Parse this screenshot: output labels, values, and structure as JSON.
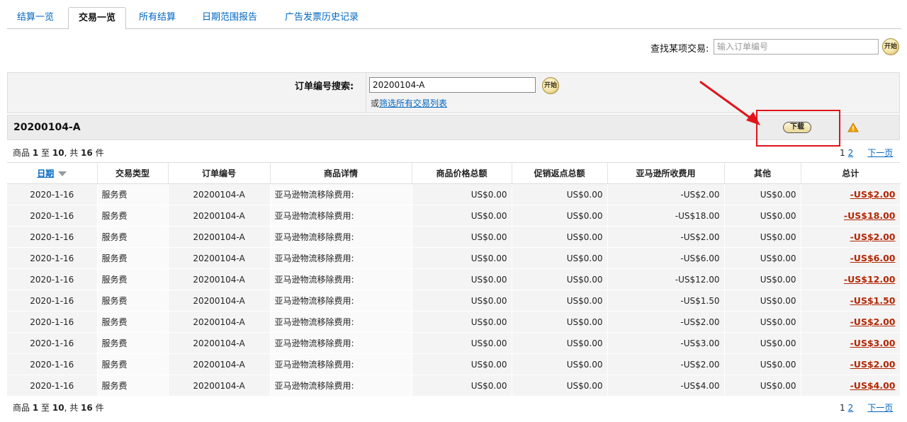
{
  "tabs": [
    {
      "label": "结算一览"
    },
    {
      "label": "交易一览"
    },
    {
      "label": "所有结算"
    },
    {
      "label": "日期范围报告"
    },
    {
      "label": "广告发票历史记录"
    }
  ],
  "find": {
    "label": "查找某项交易:",
    "placeholder": "输入订单编号",
    "go": "开始"
  },
  "order_search": {
    "label": "订单编号搜索:",
    "value": "20200104-A",
    "go": "开始",
    "or": "或",
    "filter_link": "筛选所有交易列表"
  },
  "header": {
    "title": "20200104-A",
    "download": "下载"
  },
  "summary": {
    "prefix": "商品",
    "from": "1",
    "to_word": "至",
    "to": "10",
    "total_word": ", 共",
    "total": "16",
    "unit": "件"
  },
  "pager": {
    "current": "1",
    "page2": "2",
    "next": "下一页"
  },
  "columns": [
    "日期",
    "交易类型",
    "订单编号",
    "商品详情",
    "商品价格总额",
    "促销返点总额",
    "亚马逊所收费用",
    "其他",
    "总计"
  ],
  "rows": [
    {
      "date": "2020-1-16",
      "type": "服务费",
      "order": "20200104-A",
      "detail": "亚马逊物流移除费用:",
      "price": "US$0.00",
      "promo": "US$0.00",
      "fee": "-US$2.00",
      "other": "US$0.00",
      "total": "-US$2.00"
    },
    {
      "date": "2020-1-16",
      "type": "服务费",
      "order": "20200104-A",
      "detail": "亚马逊物流移除费用:",
      "price": "US$0.00",
      "promo": "US$0.00",
      "fee": "-US$18.00",
      "other": "US$0.00",
      "total": "-US$18.00"
    },
    {
      "date": "2020-1-16",
      "type": "服务费",
      "order": "20200104-A",
      "detail": "亚马逊物流移除费用:",
      "price": "US$0.00",
      "promo": "US$0.00",
      "fee": "-US$2.00",
      "other": "US$0.00",
      "total": "-US$2.00"
    },
    {
      "date": "2020-1-16",
      "type": "服务费",
      "order": "20200104-A",
      "detail": "亚马逊物流移除费用:",
      "price": "US$0.00",
      "promo": "US$0.00",
      "fee": "-US$6.00",
      "other": "US$0.00",
      "total": "-US$6.00"
    },
    {
      "date": "2020-1-16",
      "type": "服务费",
      "order": "20200104-A",
      "detail": "亚马逊物流移除费用:",
      "price": "US$0.00",
      "promo": "US$0.00",
      "fee": "-US$12.00",
      "other": "US$0.00",
      "total": "-US$12.00"
    },
    {
      "date": "2020-1-16",
      "type": "服务费",
      "order": "20200104-A",
      "detail": "亚马逊物流移除费用:",
      "price": "US$0.00",
      "promo": "US$0.00",
      "fee": "-US$1.50",
      "other": "US$0.00",
      "total": "-US$1.50"
    },
    {
      "date": "2020-1-16",
      "type": "服务费",
      "order": "20200104-A",
      "detail": "亚马逊物流移除费用:",
      "price": "US$0.00",
      "promo": "US$0.00",
      "fee": "-US$2.00",
      "other": "US$0.00",
      "total": "-US$2.00"
    },
    {
      "date": "2020-1-16",
      "type": "服务费",
      "order": "20200104-A",
      "detail": "亚马逊物流移除费用:",
      "price": "US$0.00",
      "promo": "US$0.00",
      "fee": "-US$3.00",
      "other": "US$0.00",
      "total": "-US$3.00"
    },
    {
      "date": "2020-1-16",
      "type": "服务费",
      "order": "20200104-A",
      "detail": "亚马逊物流移除费用:",
      "price": "US$0.00",
      "promo": "US$0.00",
      "fee": "-US$2.00",
      "other": "US$0.00",
      "total": "-US$2.00"
    },
    {
      "date": "2020-1-16",
      "type": "服务费",
      "order": "20200104-A",
      "detail": "亚马逊物流移除费用:",
      "price": "US$0.00",
      "promo": "US$0.00",
      "fee": "-US$4.00",
      "other": "US$0.00",
      "total": "-US$4.00"
    }
  ],
  "colors": {
    "link": "#0066c0",
    "negative": "#b12704",
    "annotation": "#e0141a"
  }
}
